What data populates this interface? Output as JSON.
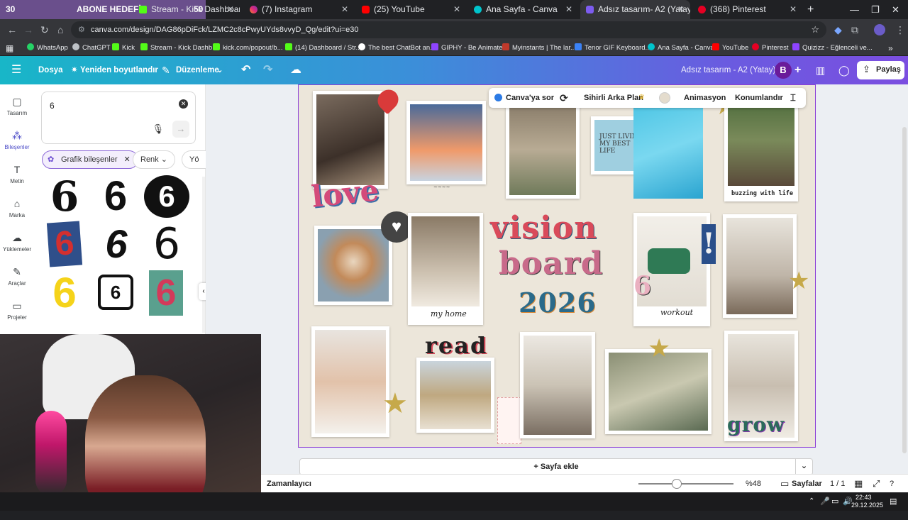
{
  "browser": {
    "tabs": [
      {
        "label": "Stream - Kick Dashboard",
        "active": false
      },
      {
        "label": "(7) Instagram",
        "active": false
      },
      {
        "label": "(25) YouTube",
        "active": false
      },
      {
        "label": "Ana Sayfa - Canva",
        "active": false
      },
      {
        "label": "Adsız tasarım- A2 (Yatay)",
        "active": true
      },
      {
        "label": "(368) Pinterest",
        "active": false
      }
    ],
    "overlay": {
      "left_num": "30",
      "title": "ABONE HEDEFİ",
      "right_num": "50"
    },
    "new_tab_label": "+",
    "url": "canva.com/design/DAG86pDiFck/LZMC2c8cPwyUYds8vvyD_Qg/edit?ui=e30",
    "bookmarks": [
      {
        "label": "WhatsApp",
        "color": "#25d366"
      },
      {
        "label": "ChatGPT",
        "color": "#bdc1c6"
      },
      {
        "label": "Kick",
        "color": "#53fc18"
      },
      {
        "label": "Stream - Kick Dashb...",
        "color": "#53fc18"
      },
      {
        "label": "kick.com/popout/b...",
        "color": "#53fc18"
      },
      {
        "label": "(14) Dashboard / Str...",
        "color": "#53fc18"
      },
      {
        "label": "The best ChatBot an...",
        "color": "#ffffff"
      },
      {
        "label": "GIPHY - Be Animated",
        "color": "#8e44ff"
      },
      {
        "label": "Myinstants | The lar...",
        "color": "#c0392b"
      },
      {
        "label": "Tenor GIF Keyboard...",
        "color": "#3b82f6"
      },
      {
        "label": "Ana Sayfa - Canva",
        "color": "#00c4cc"
      },
      {
        "label": "YouTube",
        "color": "#ff0000"
      },
      {
        "label": "Pinterest",
        "color": "#e60023"
      },
      {
        "label": "Quizizz - Eğlenceli ve...",
        "color": "#8e44ff"
      }
    ]
  },
  "canva_header": {
    "file_label": "Dosya",
    "resize_label": "Yeniden boyutlandır",
    "edit_label": "Düzenleme",
    "doc_title": "Adsız tasarım - A2 (Yatay)",
    "avatar_letter": "B",
    "share_label": "Paylaş"
  },
  "side_nav": [
    {
      "label": "Tasarım",
      "icon": "layout-icon"
    },
    {
      "label": "Bileşenler",
      "icon": "elements-icon"
    },
    {
      "label": "Metin",
      "icon": "text-icon"
    },
    {
      "label": "Marka",
      "icon": "brand-icon"
    },
    {
      "label": "Yüklemeler",
      "icon": "upload-icon"
    },
    {
      "label": "Araçlar",
      "icon": "tools-icon"
    },
    {
      "label": "Projeler",
      "icon": "folder-icon"
    }
  ],
  "panel": {
    "search_value": "6",
    "chip_active": "Grafik bileşenler",
    "chip_color": "Renk",
    "chip_more": "Yö",
    "results_glyph": "6"
  },
  "float_toolbar": {
    "ask_canva": "Canva'ya sor",
    "magic_bg": "Sihirli Arka Plan",
    "animation": "Animasyon",
    "position": "Konumlandır"
  },
  "board": {
    "love": "love",
    "vision": "vision",
    "board_word": "board",
    "year": "2026",
    "read": "read",
    "grow": "grow",
    "just_living": "JUST LIVING MY BEST LIFE",
    "buzzing": "buzzing with life",
    "my_home": "my home",
    "workout": "workout",
    "six_sticker": "6",
    "exclaim": "!"
  },
  "bottom": {
    "add_page": "+ Sayfa ekle",
    "timer": "Zamanlayıcı",
    "zoom": "%48",
    "zoom_fraction": 0.4,
    "pages_label": "Sayfalar",
    "page_count": "1 / 1"
  },
  "taskbar": {
    "time": "22:43",
    "date": "29.12.2025"
  }
}
